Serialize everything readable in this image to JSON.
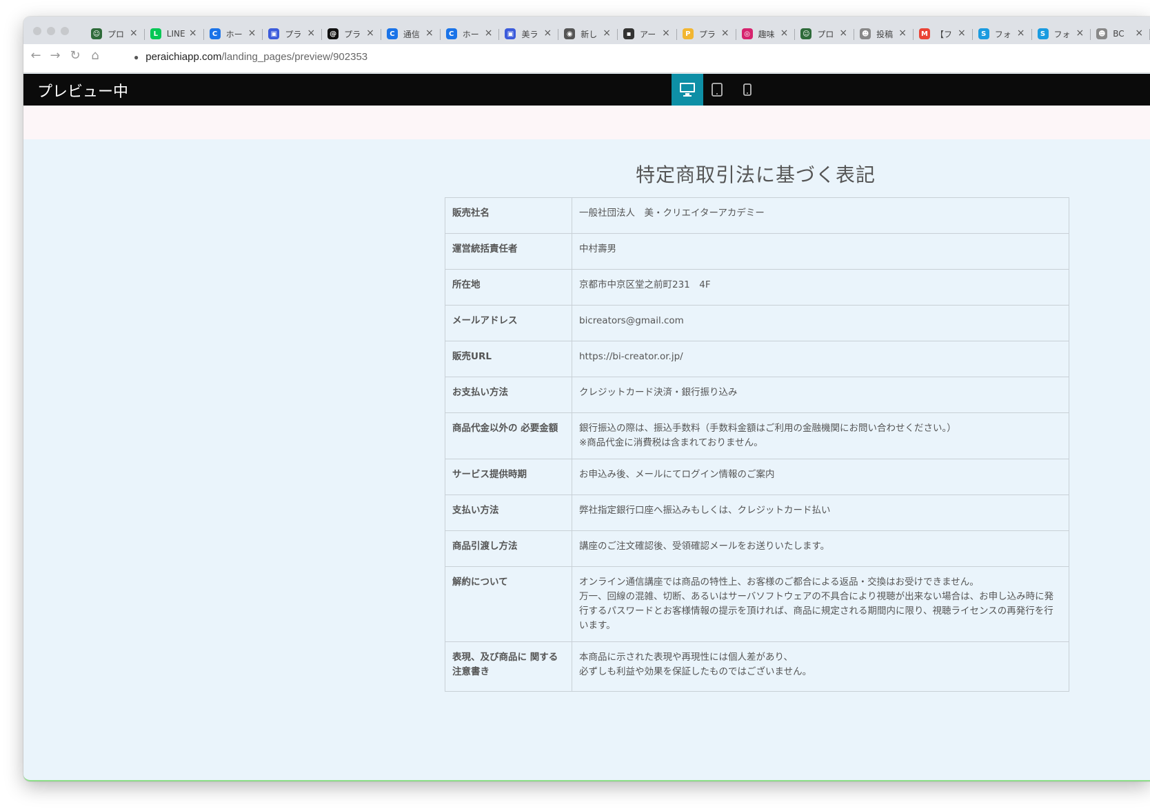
{
  "browser": {
    "tabs": [
      {
        "title": "プロ",
        "icon": "robot-icon",
        "color": "#2f6b3a"
      },
      {
        "title": "LINE",
        "icon": "line-icon",
        "color": "#06c755"
      },
      {
        "title": "ホー",
        "icon": "c-icon",
        "color": "#1a73e8"
      },
      {
        "title": "プラ",
        "icon": "window-icon",
        "color": "#3b5bdb"
      },
      {
        "title": "プラ",
        "icon": "threads-icon",
        "color": "#111111"
      },
      {
        "title": "通信",
        "icon": "c-icon",
        "color": "#1a73e8"
      },
      {
        "title": "ホー",
        "icon": "c-icon",
        "color": "#1a73e8"
      },
      {
        "title": "美ラ",
        "icon": "window-icon",
        "color": "#3b5bdb"
      },
      {
        "title": "新し",
        "icon": "chrome-icon",
        "color": "#555555"
      },
      {
        "title": "アー",
        "icon": "image-icon",
        "color": "#333333"
      },
      {
        "title": "プラ",
        "icon": "p-icon",
        "color": "#f2b632"
      },
      {
        "title": "趣味",
        "icon": "instagram-icon",
        "color": "#d6246e"
      },
      {
        "title": "プロ",
        "icon": "robot-icon",
        "color": "#2f6b3a"
      },
      {
        "title": "投稿",
        "icon": "ghost-icon",
        "color": "#888888"
      },
      {
        "title": "【フ",
        "icon": "gmail-icon",
        "color": "#ea4335"
      },
      {
        "title": "フォ",
        "icon": "s-icon",
        "color": "#1a9be0"
      },
      {
        "title": "フォ",
        "icon": "s-icon",
        "color": "#1a9be0"
      },
      {
        "title": "BC",
        "icon": "ghost-icon",
        "color": "#888888"
      }
    ],
    "url_host": "peraichiapp.com",
    "url_path": "/landing_pages/preview/902353"
  },
  "preview": {
    "title": "プレビュー中",
    "devices": [
      "desktop-icon",
      "tablet-icon",
      "mobile-icon"
    ],
    "active_device": "desktop-icon"
  },
  "content": {
    "heading": "特定商取引法に基づく表記",
    "rows": [
      {
        "label": "販売社名",
        "value": "一般社団法人　美・クリエイターアカデミー"
      },
      {
        "label": "運営統括責任者",
        "value": "中村壽男"
      },
      {
        "label": "所在地",
        "value": "京都市中京区堂之前町231　4F"
      },
      {
        "label": "メールアドレス",
        "value": "bicreators@gmail.com"
      },
      {
        "label": "販売URL",
        "value": "https://bi-creator.or.jp/"
      },
      {
        "label": "お支払い方法",
        "value": "クレジットカード決済・銀行振り込み"
      },
      {
        "label": "商品代金以外の 必要金額",
        "value": "銀行振込の際は、振込手数料（手数料金額はご利用の金融機関にお問い合わせください。）\n※商品代金に消費税は含まれておりません。"
      },
      {
        "label": "サービス提供時期",
        "value": "お申込み後、メールにてログイン情報のご案内"
      },
      {
        "label": "支払い方法",
        "value": "弊社指定銀行口座へ振込みもしくは、クレジットカード払い"
      },
      {
        "label": "商品引渡し方法",
        "value": "講座のご注文確認後、受領確認メールをお送りいたします。"
      },
      {
        "label": "解約について",
        "value": "オンライン通信講座では商品の特性上、お客様のご都合による返品・交換はお受けできません。\n万一、回線の混雑、切断、あるいはサーバソフトウェアの不具合により視聴が出来ない場合は、お申し込み時に発行するパスワードとお客様情報の提示を頂ければ、商品に規定される期間内に限り、視聴ライセンスの再発行を行います。"
      },
      {
        "label": "表現、及び商品に 関する注意書き",
        "value": "本商品に示された表現や再現性には個人差があり、\n必ずしも利益や効果を保証したものではございません。"
      }
    ]
  }
}
